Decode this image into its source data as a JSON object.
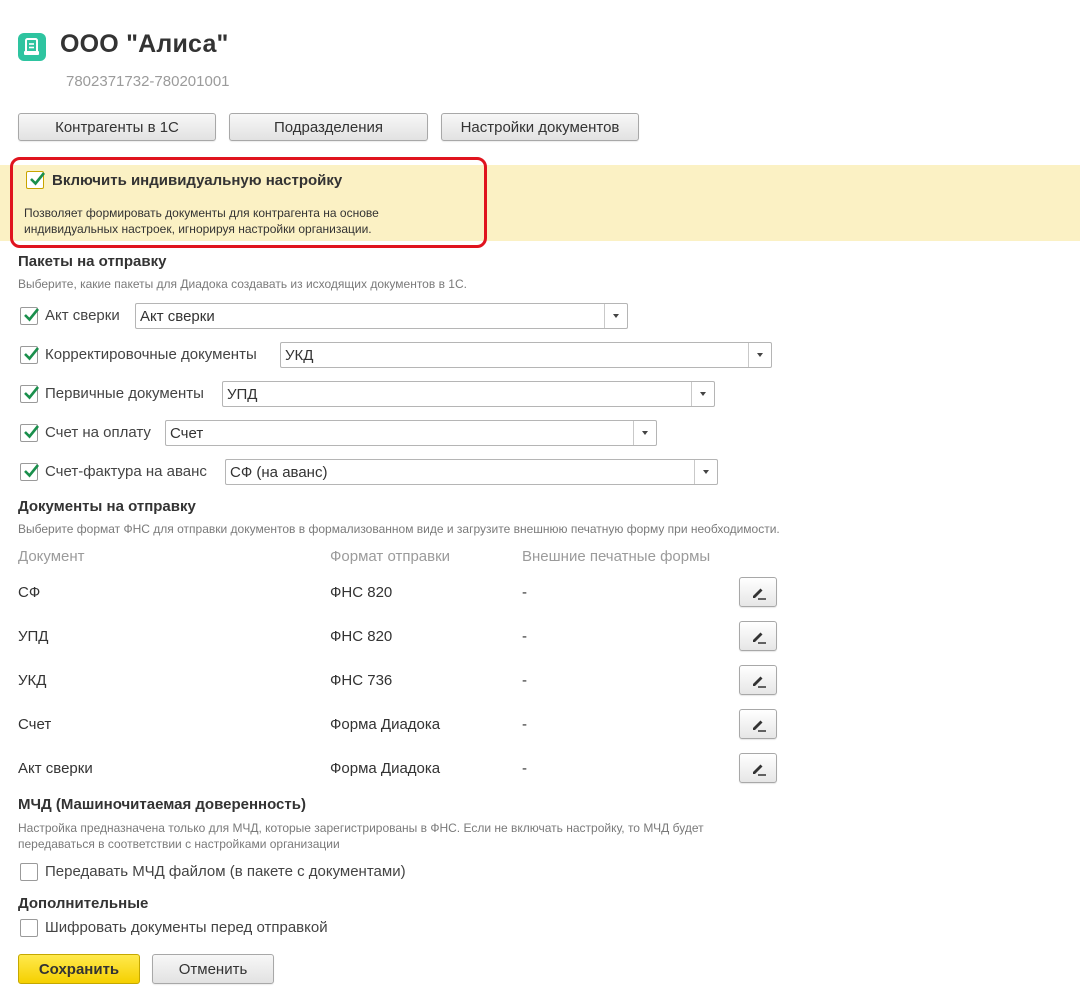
{
  "header": {
    "title": "ООО \"Алиса\"",
    "subtitle": "7802371732-780201001",
    "logo_icon": "document-stamp-icon",
    "logo_color": "#2ec4a0"
  },
  "toolbar": {
    "counterparties_label": "Контрагенты в 1С",
    "divisions_label": "Подразделения",
    "doc_settings_label": "Настройки документов"
  },
  "individual": {
    "checked": true,
    "label": "Включить индивидуальную настройку",
    "desc_line1": "Позволяет формировать документы для контрагента на основе",
    "desc_line2": "индивидуальных настроек, игнорируя настройки организации.",
    "highlight_color": "#fbf1c4",
    "frame_color": "#e0141e"
  },
  "packages": {
    "title": "Пакеты на отправку",
    "desc": "Выберите, какие пакеты для Диадока создавать из исходящих документов в 1С.",
    "items": [
      {
        "label": "Акт сверки",
        "value": "Акт сверки",
        "checked": true
      },
      {
        "label": "Корректировочные документы",
        "value": "УКД",
        "checked": true
      },
      {
        "label": "Первичные документы",
        "value": "УПД",
        "checked": true
      },
      {
        "label": "Счет на оплату",
        "value": "Счет",
        "checked": true
      },
      {
        "label": "Счет-фактура на аванс",
        "value": "СФ (на аванс)",
        "checked": true
      }
    ]
  },
  "documents": {
    "title": "Документы на отправку",
    "desc": "Выберите формат ФНС для отправки документов в формализованном виде и загрузите внешнюю печатную форму при необходимости.",
    "columns": [
      "Документ",
      "Формат отправки",
      "Внешние печатные формы"
    ],
    "rows": [
      {
        "doc": "СФ",
        "format": "ФНС 820",
        "forms": "-"
      },
      {
        "doc": "УПД",
        "format": "ФНС 820",
        "forms": "-"
      },
      {
        "doc": "УКД",
        "format": "ФНС 736",
        "forms": "-"
      },
      {
        "doc": "Счет",
        "format": "Форма Диадока",
        "forms": "-"
      },
      {
        "doc": "Акт сверки",
        "format": "Форма Диадока",
        "forms": "-"
      }
    ]
  },
  "mchd": {
    "title": "МЧД (Машиночитаемая доверенность)",
    "desc_line1": "Настройка предназначена только для МЧД, которые зарегистрированы в ФНС. Если не включать настройку, то МЧД будет",
    "desc_line2": "передаваться в соответствии с настройками организации",
    "option_label": "Передавать МЧД файлом (в пакете с документами)",
    "option_checked": false
  },
  "additional": {
    "title": "Дополнительные",
    "option_label": "Шифровать документы перед отправкой",
    "option_checked": false
  },
  "footer": {
    "save_label": "Сохранить",
    "cancel_label": "Отменить",
    "save_color": "#f5d000"
  },
  "check_color": "#1a8f4c"
}
